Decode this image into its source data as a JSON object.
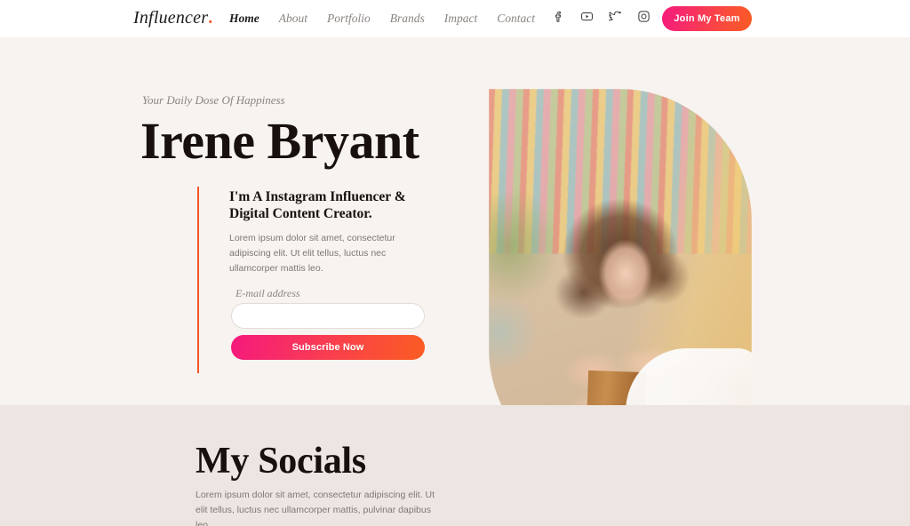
{
  "header": {
    "logo_text": "Influencer",
    "logo_dot": ".",
    "nav": [
      {
        "label": "Home",
        "active": true
      },
      {
        "label": "About",
        "active": false
      },
      {
        "label": "Portfolio",
        "active": false
      },
      {
        "label": "Brands",
        "active": false
      },
      {
        "label": "Impact",
        "active": false
      },
      {
        "label": "Contact",
        "active": false
      }
    ],
    "social_icons": [
      {
        "name": "facebook-icon",
        "label": "Facebook"
      },
      {
        "name": "youtube-icon",
        "label": "YouTube"
      },
      {
        "name": "twitter-icon",
        "label": "Twitter"
      },
      {
        "name": "instagram-icon",
        "label": "Instagram"
      }
    ],
    "cta_label": "Join My Team"
  },
  "hero": {
    "eyebrow": "Your Daily Dose Of Happiness",
    "title": "Irene Bryant",
    "subtitle": "I'm A Instagram Influencer & Digital Content Creator.",
    "body": "Lorem ipsum dolor sit amet, consectetur adipiscing elit. Ut elit tellus, luctus nec ullamcorper mattis leo.",
    "email_label": "E-mail address",
    "email_value": "",
    "email_placeholder": "",
    "subscribe_label": "Subscribe Now",
    "portrait_alt": "Portrait of Irene Bryant with curly hair resting chin on hand"
  },
  "socials_section": {
    "title": "My Socials",
    "body": "Lorem ipsum dolor sit amet, consectetur adipiscing elit. Ut elit tellus, luctus nec ullamcorper mattis, pulvinar dapibus leo."
  },
  "colors": {
    "header_bg": "#ffffff",
    "hero_bg": "#f7f3f0",
    "socials_bg": "#ede5e1",
    "accent_line": "#f4562a",
    "logo_dot": "#f4562a",
    "gradient_start": "#f6197d",
    "gradient_end": "#fb5c23",
    "heading_text": "#17100d",
    "muted_text": "#8a8480",
    "body_text": "#7e7874"
  }
}
